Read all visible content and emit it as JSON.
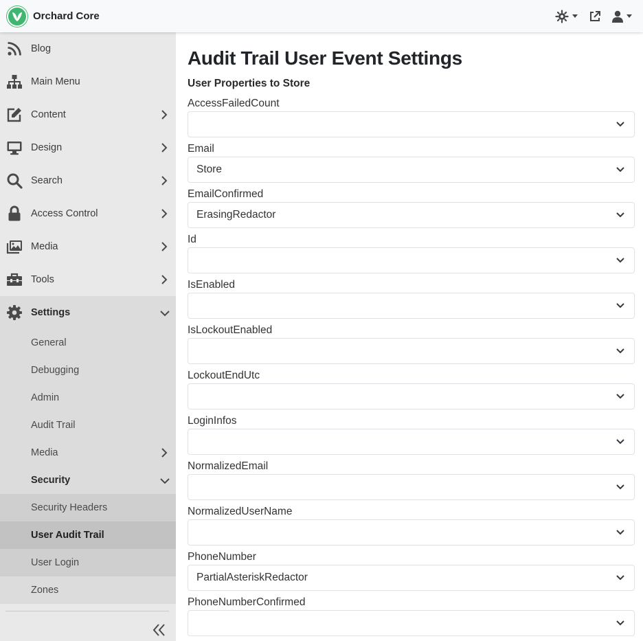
{
  "app": {
    "title": "Orchard Core"
  },
  "sidebar": {
    "items": [
      {
        "label": "Blog",
        "icon": "rss-icon",
        "has_children": false
      },
      {
        "label": "Main Menu",
        "icon": "sitemap-icon",
        "has_children": false
      },
      {
        "label": "Content",
        "icon": "edit-icon",
        "has_children": true
      },
      {
        "label": "Design",
        "icon": "monitor-icon",
        "has_children": true
      },
      {
        "label": "Search",
        "icon": "search-icon",
        "has_children": true
      },
      {
        "label": "Access Control",
        "icon": "lock-icon",
        "has_children": true
      },
      {
        "label": "Media",
        "icon": "images-icon",
        "has_children": true
      },
      {
        "label": "Tools",
        "icon": "toolbox-icon",
        "has_children": true
      },
      {
        "label": "Settings",
        "icon": "gear-icon",
        "has_children": true,
        "expanded": true
      }
    ],
    "settings_children": [
      {
        "label": "General"
      },
      {
        "label": "Debugging"
      },
      {
        "label": "Admin"
      },
      {
        "label": "Audit Trail"
      },
      {
        "label": "Media",
        "has_children": true
      },
      {
        "label": "Security",
        "has_children": true,
        "expanded": true
      }
    ],
    "security_children": [
      {
        "label": "Security Headers"
      },
      {
        "label": "User Audit Trail",
        "active": true
      },
      {
        "label": "User Login"
      }
    ],
    "zones_label": "Zones"
  },
  "page": {
    "title": "Audit Trail User Event Settings",
    "section_title": "User Properties to Store",
    "fields": [
      {
        "label": "AccessFailedCount",
        "value": ""
      },
      {
        "label": "Email",
        "value": "Store"
      },
      {
        "label": "EmailConfirmed",
        "value": "ErasingRedactor"
      },
      {
        "label": "Id",
        "value": ""
      },
      {
        "label": "IsEnabled",
        "value": ""
      },
      {
        "label": "IsLockoutEnabled",
        "value": ""
      },
      {
        "label": "LockoutEndUtc",
        "value": ""
      },
      {
        "label": "LoginInfos",
        "value": ""
      },
      {
        "label": "NormalizedEmail",
        "value": ""
      },
      {
        "label": "NormalizedUserName",
        "value": ""
      },
      {
        "label": "PhoneNumber",
        "value": "PartialAsteriskRedactor"
      },
      {
        "label": "PhoneNumberConfirmed",
        "value": ""
      }
    ]
  },
  "colors": {
    "brand": "#41b670",
    "sidebar_bg": "#e9e9e9",
    "active_bg": "#c2c2c2"
  }
}
